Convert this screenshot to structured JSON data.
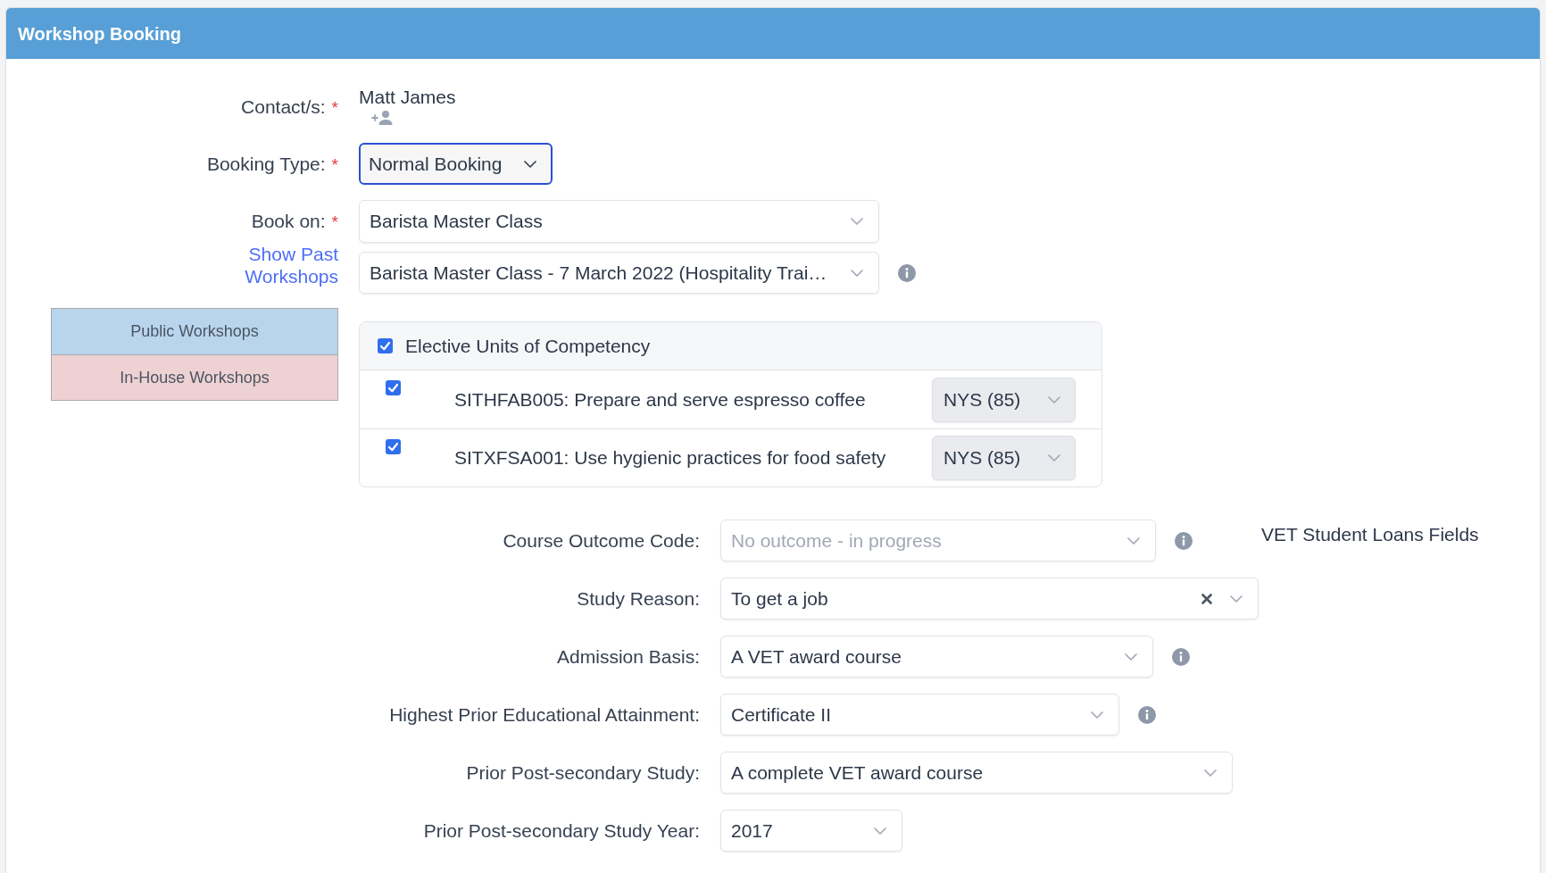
{
  "panel": {
    "title": "Workshop Booking"
  },
  "contact": {
    "label": "Contact/s:",
    "required_mark": "*",
    "name": "Matt James"
  },
  "booking_type": {
    "label": "Booking Type:",
    "required_mark": "*",
    "value": "Normal Booking",
    "focused": true
  },
  "book_on": {
    "label": "Book on:",
    "required_mark": "*",
    "course": "Barista Master Class",
    "workshop": "Barista Master Class - 7 March 2022 (Hospitality Trai…",
    "workshop_info": true
  },
  "past_workshops_link": "Show Past Workshops",
  "workshop_tabs": [
    {
      "label": "Public Workshops",
      "color": "#b9d5ed"
    },
    {
      "label": "In-House Workshops",
      "color": "#eed1d3"
    }
  ],
  "elective_units": {
    "label": "Elective Units of Competency",
    "checked": true,
    "units": [
      {
        "name": "SITHFAB005: Prepare and serve espresso coffee",
        "checked": true,
        "outcome": "NYS (85)"
      },
      {
        "name": "SITXFSA001: Use hygienic practices for food safety",
        "checked": true,
        "outcome": "NYS (85)"
      }
    ]
  },
  "vet_section": {
    "heading": "VET Student Loans Fields",
    "fields": [
      {
        "label": "Course Outcome Code:",
        "value": "No outcome - in progress",
        "disabled": true,
        "info": true,
        "clearable": false
      },
      {
        "label": "Study Reason:",
        "value": "To get a job",
        "disabled": false,
        "info": false,
        "clearable": true
      },
      {
        "label": "Admission Basis:",
        "value": "A VET award course",
        "disabled": false,
        "info": true,
        "clearable": false
      },
      {
        "label": "Highest Prior Educational Attainment:",
        "value": "Certificate II",
        "disabled": false,
        "info": true,
        "clearable": false
      },
      {
        "label": "Prior Post-secondary Study:",
        "value": "A complete VET award course",
        "disabled": false,
        "info": false,
        "clearable": false
      },
      {
        "label": "Prior Post-secondary Study Year:",
        "value": "2017",
        "disabled": false,
        "info": false,
        "clearable": false
      }
    ]
  }
}
